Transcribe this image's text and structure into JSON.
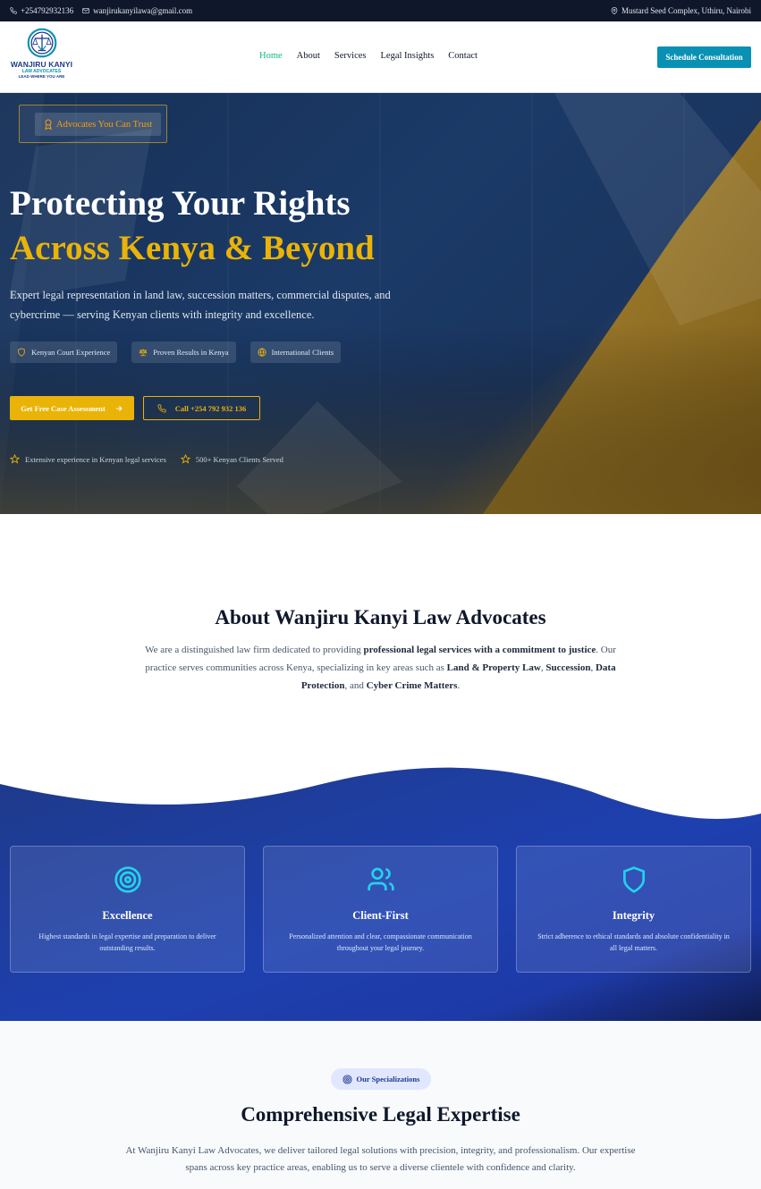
{
  "topbar": {
    "phone": "+254792932136",
    "email": "wanjirukanyilawa@gmail.com",
    "address": "Mustard Seed Complex, Uthiru, Nairobi"
  },
  "logo": {
    "name": "WANJIRU KANYI",
    "sub": "LAW ADVOCATES",
    "tagline": "LEAD WHERE YOU ARE"
  },
  "nav": {
    "items": [
      {
        "label": "Home",
        "active": true
      },
      {
        "label": "About",
        "active": false
      },
      {
        "label": "Services",
        "active": false
      },
      {
        "label": "Legal Insights",
        "active": false
      },
      {
        "label": "Contact",
        "active": false
      }
    ],
    "cta": "Schedule Consultation"
  },
  "hero": {
    "badge": "Advocates You Can Trust",
    "title_line1": "Protecting Your Rights",
    "title_line2": "Across Kenya & Beyond",
    "description": "Expert legal representation in land law, succession matters, commercial disputes, and cybercrime — serving Kenyan clients with integrity and excellence.",
    "pills": [
      {
        "label": "Kenyan Court Experience",
        "icon": "shield-icon"
      },
      {
        "label": "Proven Results in Kenya",
        "icon": "scale-icon"
      },
      {
        "label": "International Clients",
        "icon": "globe-icon"
      }
    ],
    "primary_button": "Get Free Case Assessment",
    "secondary_button": "Call +254 792 932 136",
    "stats": [
      "Extensive experience in Kenyan legal services",
      "500+ Kenyan Clients Served"
    ]
  },
  "about": {
    "title": "About Wanjiru Kanyi Law Advocates",
    "text_parts": [
      {
        "text": "We are a distinguished law firm dedicated to providing ",
        "bold": false
      },
      {
        "text": "professional legal services with a commitment to justice",
        "bold": true
      },
      {
        "text": ". Our practice serves communities across Kenya, specializing in key areas such as ",
        "bold": false
      },
      {
        "text": "Land & Property Law",
        "bold": true
      },
      {
        "text": ", ",
        "bold": false
      },
      {
        "text": "Succession",
        "bold": true
      },
      {
        "text": ", ",
        "bold": false
      },
      {
        "text": "Data Protection",
        "bold": true
      },
      {
        "text": ", and ",
        "bold": false
      },
      {
        "text": "Cyber Crime Matters",
        "bold": true
      },
      {
        "text": ".",
        "bold": false
      }
    ]
  },
  "values": [
    {
      "title": "Excellence",
      "description": "Highest standards in legal expertise and preparation to deliver outstanding results.",
      "icon": "target-icon"
    },
    {
      "title": "Client-First",
      "description": "Personalized attention and clear, compassionate communication throughout your legal journey.",
      "icon": "users-icon"
    },
    {
      "title": "Integrity",
      "description": "Strict adherence to ethical standards and absolute confidentiality in all legal matters.",
      "icon": "shield-icon"
    }
  ],
  "specializations": {
    "badge": "Our Specializations",
    "title": "Comprehensive Legal Expertise",
    "text": "At Wanjiru Kanyi Law Advocates, we deliver tailored legal solutions with precision, integrity, and professionalism. Our expertise spans across key practice areas, enabling us to serve a diverse clientele with confidence and clarity."
  },
  "colors": {
    "accent_gold": "#eab308",
    "nav_active": "#10b981",
    "cta_teal": "#0891b2",
    "hero_navy": "#173158",
    "values_blue": "#1e40af"
  }
}
